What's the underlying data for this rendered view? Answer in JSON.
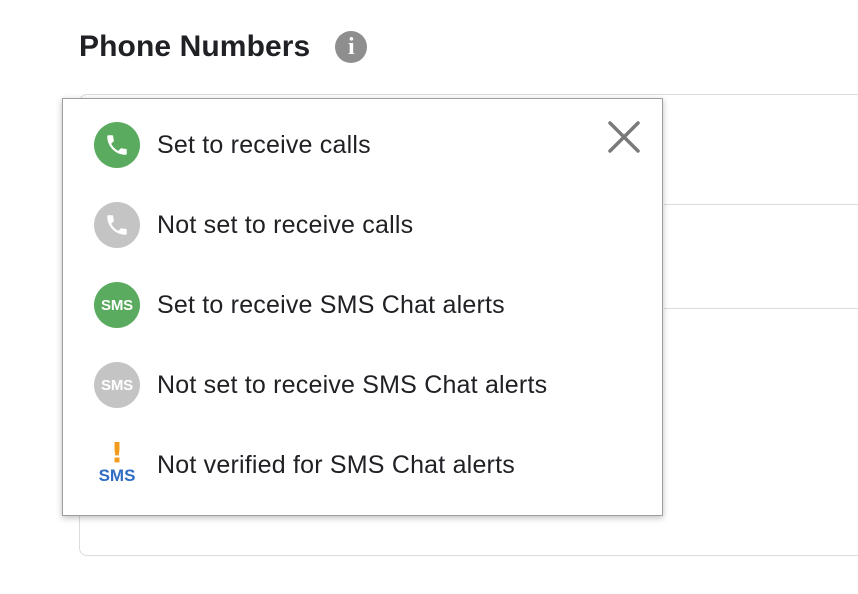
{
  "section": {
    "title": "Phone Numbers",
    "info_icon": "info-icon"
  },
  "legend": {
    "close_icon": "close-icon",
    "items": [
      {
        "label": "Set to receive calls",
        "icon": "phone-icon",
        "color": "#5aab5f"
      },
      {
        "label": "Not set to receive calls",
        "icon": "phone-icon",
        "color": "#c4c4c4"
      },
      {
        "label": "Set to receive SMS Chat alerts",
        "icon": "sms-icon",
        "icon_text": "SMS",
        "color": "#5aab5f"
      },
      {
        "label": "Not set to receive SMS Chat alerts",
        "icon": "sms-icon",
        "icon_text": "SMS",
        "color": "#c4c4c4"
      },
      {
        "label": "Not verified for SMS Chat alerts",
        "icon": "sms-unverified-icon",
        "icon_mark": "!",
        "icon_text": "SMS",
        "mark_color": "#f29b1d",
        "text_color": "#2f6cc4"
      }
    ]
  }
}
